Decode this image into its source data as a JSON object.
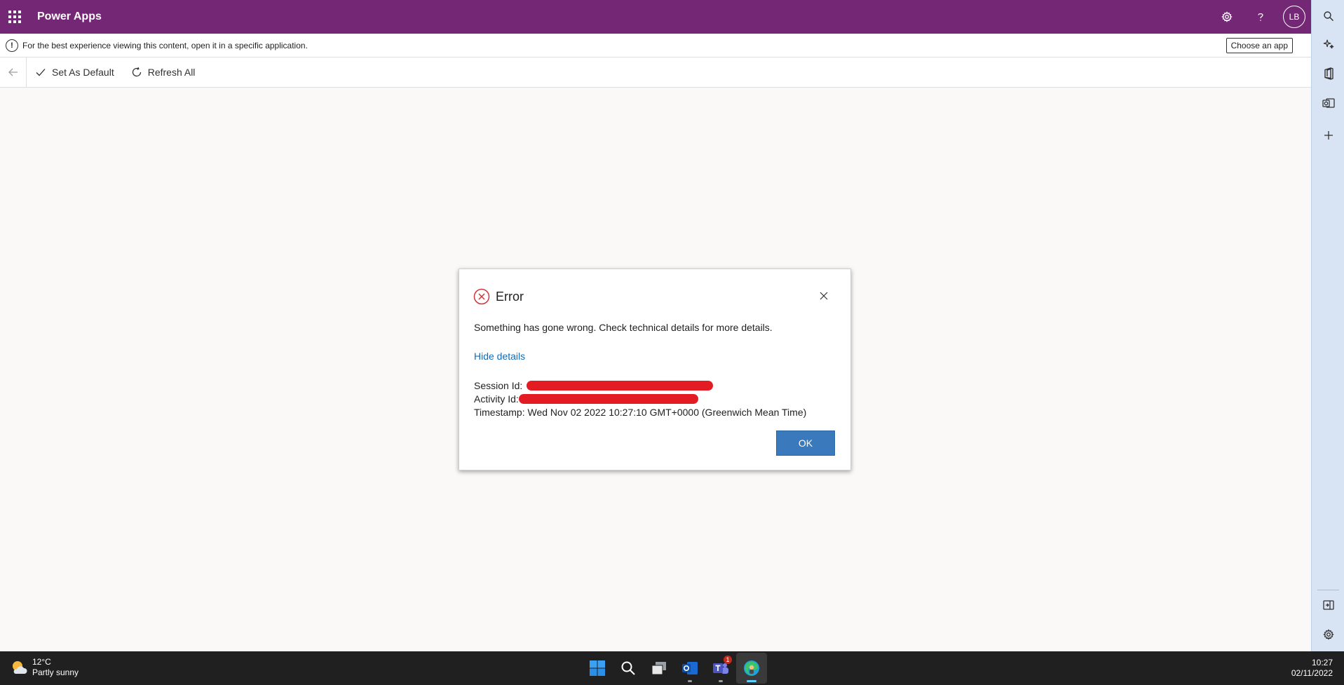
{
  "app": {
    "title": "Power Apps",
    "avatar_initials": "LB"
  },
  "infobar": {
    "message": "For the best experience viewing this content, open it in a specific application.",
    "choose_app_label": "Choose an app"
  },
  "commandbar": {
    "set_default_label": "Set As Default",
    "refresh_label": "Refresh All"
  },
  "dialog": {
    "title": "Error",
    "message": "Something has gone wrong. Check technical details for more details.",
    "toggle_details_label": "Hide details",
    "session_label": "Session Id:",
    "activity_label": "Activity Id:",
    "timestamp_line": "Timestamp: Wed Nov 02 2022 10:27:10 GMT+0000 (Greenwich Mean Time)",
    "ok_label": "OK"
  },
  "taskbar": {
    "weather_temp": "12°C",
    "weather_desc": "Partly sunny",
    "teams_badge": "1",
    "time": "10:27",
    "date": "02/11/2022"
  },
  "colors": {
    "brand": "#742774",
    "ok_button": "#3b79bd",
    "error": "#d13438",
    "link": "#0f6cbd"
  }
}
